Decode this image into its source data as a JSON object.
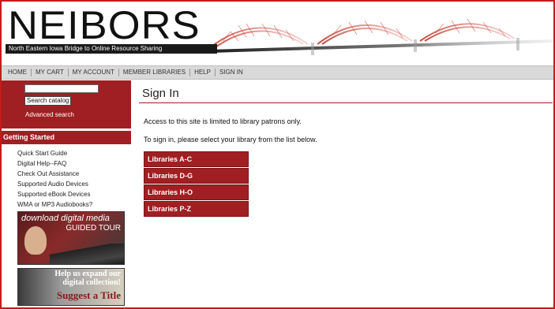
{
  "header": {
    "logo_title": "NEIBORS",
    "logo_subtitle": "North Eastern Iowa Bridge to Online Resource Sharing",
    "colors": {
      "brand_red": "#a01f22",
      "border_red": "#c21b1b"
    }
  },
  "nav": {
    "items": [
      {
        "label": "HOME"
      },
      {
        "label": "MY CART"
      },
      {
        "label": "MY ACCOUNT"
      },
      {
        "label": "MEMBER LIBRARIES"
      },
      {
        "label": "HELP"
      },
      {
        "label": "SIGN IN"
      }
    ]
  },
  "sidebar": {
    "search": {
      "value": "",
      "button_label": "Search catalog",
      "advanced_label": "Advanced search"
    },
    "getting_started": {
      "header": "Getting Started",
      "links": [
        {
          "label": "Quick Start Guide"
        },
        {
          "label": "Digital Help--FAQ"
        },
        {
          "label": "Check Out Assistance"
        },
        {
          "label": "Supported Audio Devices"
        },
        {
          "label": "Supported eBook Devices"
        },
        {
          "label": "WMA or MP3 Audiobooks?"
        }
      ]
    },
    "promo_tour": {
      "line1": "download digital media",
      "line2": "GUIDED TOUR"
    },
    "promo_suggest": {
      "line1": "Help us expand our",
      "line2": "digital collection!",
      "line3": "Suggest a Title"
    }
  },
  "main": {
    "title": "Sign In",
    "intro": "Access to this site is limited to library patrons only.",
    "instruction": "To sign in, please select your library from the list below.",
    "libraries": [
      {
        "label": "Libraries A-C"
      },
      {
        "label": "Libraries D-G"
      },
      {
        "label": "Libraries H-O"
      },
      {
        "label": "Libraries P-Z"
      }
    ]
  }
}
